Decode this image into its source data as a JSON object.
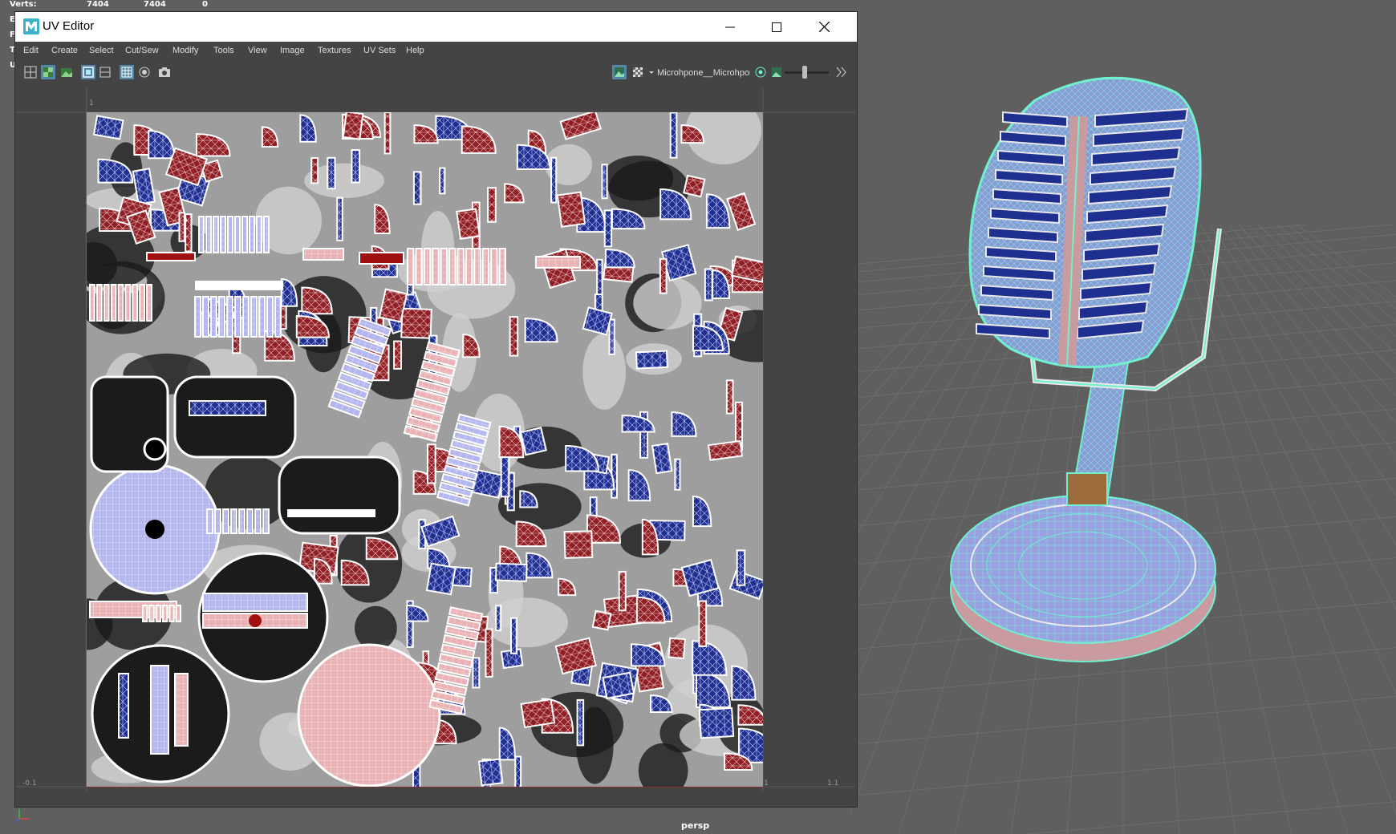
{
  "hud": {
    "rows": [
      {
        "label": "Verts:",
        "v1": "7404",
        "v2": "7404",
        "v3": "0"
      },
      {
        "label": "E"
      },
      {
        "label": "F"
      },
      {
        "label": "T"
      },
      {
        "label": "U"
      }
    ]
  },
  "viewport": {
    "camera_label": "persp"
  },
  "uv_editor": {
    "title": "UV Editor",
    "menu": [
      "Edit",
      "Create",
      "Select",
      "Cut/Sew",
      "Modify",
      "Tools",
      "View",
      "Image",
      "Textures",
      "UV Sets",
      "Help"
    ],
    "texture_name": "Microhpone__Microhpone",
    "slider_value": 0.45,
    "axis_ticks": {
      "top": "1",
      "bottom_left": "-0.1",
      "bottom_right_1": "1",
      "bottom_right_2": "1.1"
    }
  },
  "colors": {
    "uv_blue": "#1f2f8f",
    "uv_red": "#8f1f24",
    "uv_light_blue": "#b3b6ef",
    "uv_pink": "#eab2b4",
    "wire_cyan": "#6ff1cf",
    "accent": "#5285a6"
  }
}
